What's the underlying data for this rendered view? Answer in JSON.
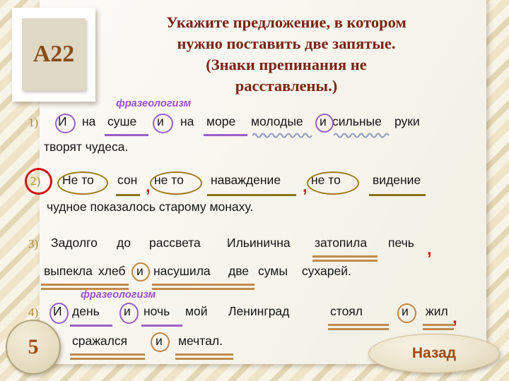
{
  "badge": {
    "code": "A22"
  },
  "title": {
    "lines": [
      "Укажите предложение, в котором",
      "нужно поставить две запятые.",
      "(Знаки препинания не",
      "расставлены.)"
    ]
  },
  "labels": {
    "phraseologism": "фразеологизм"
  },
  "questions": [
    {
      "number": "1)",
      "line1": {
        "w_I": "И",
        "w_na1": "на",
        "w_sushe": "суше",
        "w_i2": "и",
        "w_na2": "на",
        "w_more": "море",
        "w_molodye": "молодые",
        "w_i3": "и",
        "w_silnye": "сильные",
        "w_ruki": "руки"
      },
      "line2": "творят чудеса."
    },
    {
      "number": "2)",
      "line1": {
        "w_neto1": "Не то",
        "w_son": "сон",
        "comma1": ",",
        "w_neto2": "не то",
        "w_navazhdenie": "наваждение",
        "comma2": ",",
        "w_neto3": "не то",
        "w_videnie": "видение"
      },
      "line2": "чудное показалось старому монаху.",
      "correct": true
    },
    {
      "number": "3)",
      "line1": {
        "w_zadolgo": "Задолго",
        "w_do": "до",
        "w_rassveta": "рассвета",
        "w_ilyinichna": "Ильинична",
        "w_zatopila": "затопила",
        "w_pech": "печь",
        "comma1": ","
      },
      "line2": {
        "w_vypekla": "выпекла",
        "w_hleb": "хлеб",
        "w_i": "и",
        "w_nasushila": "насушила",
        "w_dve": "две",
        "w_sumy": "сумы",
        "w_suharey": "сухарей."
      }
    },
    {
      "number": "4)",
      "line1": {
        "w_I": "И",
        "w_den": "день",
        "w_i2": "и",
        "w_noch": "ночь",
        "w_moy": "мой",
        "w_leningrad": "Ленинград",
        "w_stoyal": "стоял",
        "w_i3": "и",
        "w_zhil": "жил",
        "comma1": ","
      },
      "line2": {
        "w_srazhalsya": "сражался",
        "w_i": "и",
        "w_mechtal": "мечтал."
      }
    }
  ],
  "footer": {
    "page_number": "5",
    "back_label": "Назад"
  },
  "colors": {
    "title": "#7a2414",
    "badge_text": "#8a4a16",
    "purple_mark": "#9a5fc4",
    "gold_mark": "#9c7a1b",
    "tan_mark": "#c08a4d",
    "red_mark": "#cf1111",
    "phrase_label": "#9b4fd0"
  }
}
